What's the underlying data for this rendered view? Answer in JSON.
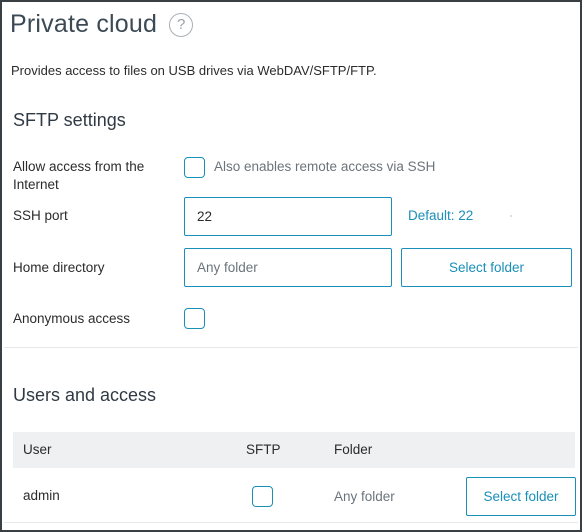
{
  "header": {
    "title": "Private cloud",
    "help_icon": "question-circle-icon"
  },
  "description": "Provides access to files on USB drives via WebDAV/SFTP/FTP.",
  "sftp_settings": {
    "section_title": "SFTP settings",
    "internet_access": {
      "label": "Allow access from the Internet",
      "checked": false,
      "hint": "Also enables remote access via SSH"
    },
    "ssh_port": {
      "label": "SSH port",
      "value": "22",
      "default_text": "Default: 22"
    },
    "home_directory": {
      "label": "Home directory",
      "placeholder": "Any folder",
      "button_label": "Select folder"
    },
    "anonymous_access": {
      "label": "Anonymous access",
      "checked": false
    }
  },
  "users": {
    "section_title": "Users and access",
    "columns": [
      "User",
      "SFTP",
      "Folder"
    ],
    "rows": [
      {
        "user": "admin",
        "sftp": false,
        "folder": "Any folder",
        "button_label": "Select folder"
      }
    ]
  },
  "colors": {
    "accent": "#1a8fb8",
    "title": "#3c4a55",
    "muted": "#6b747b",
    "table_header_bg": "#eef0f2"
  }
}
